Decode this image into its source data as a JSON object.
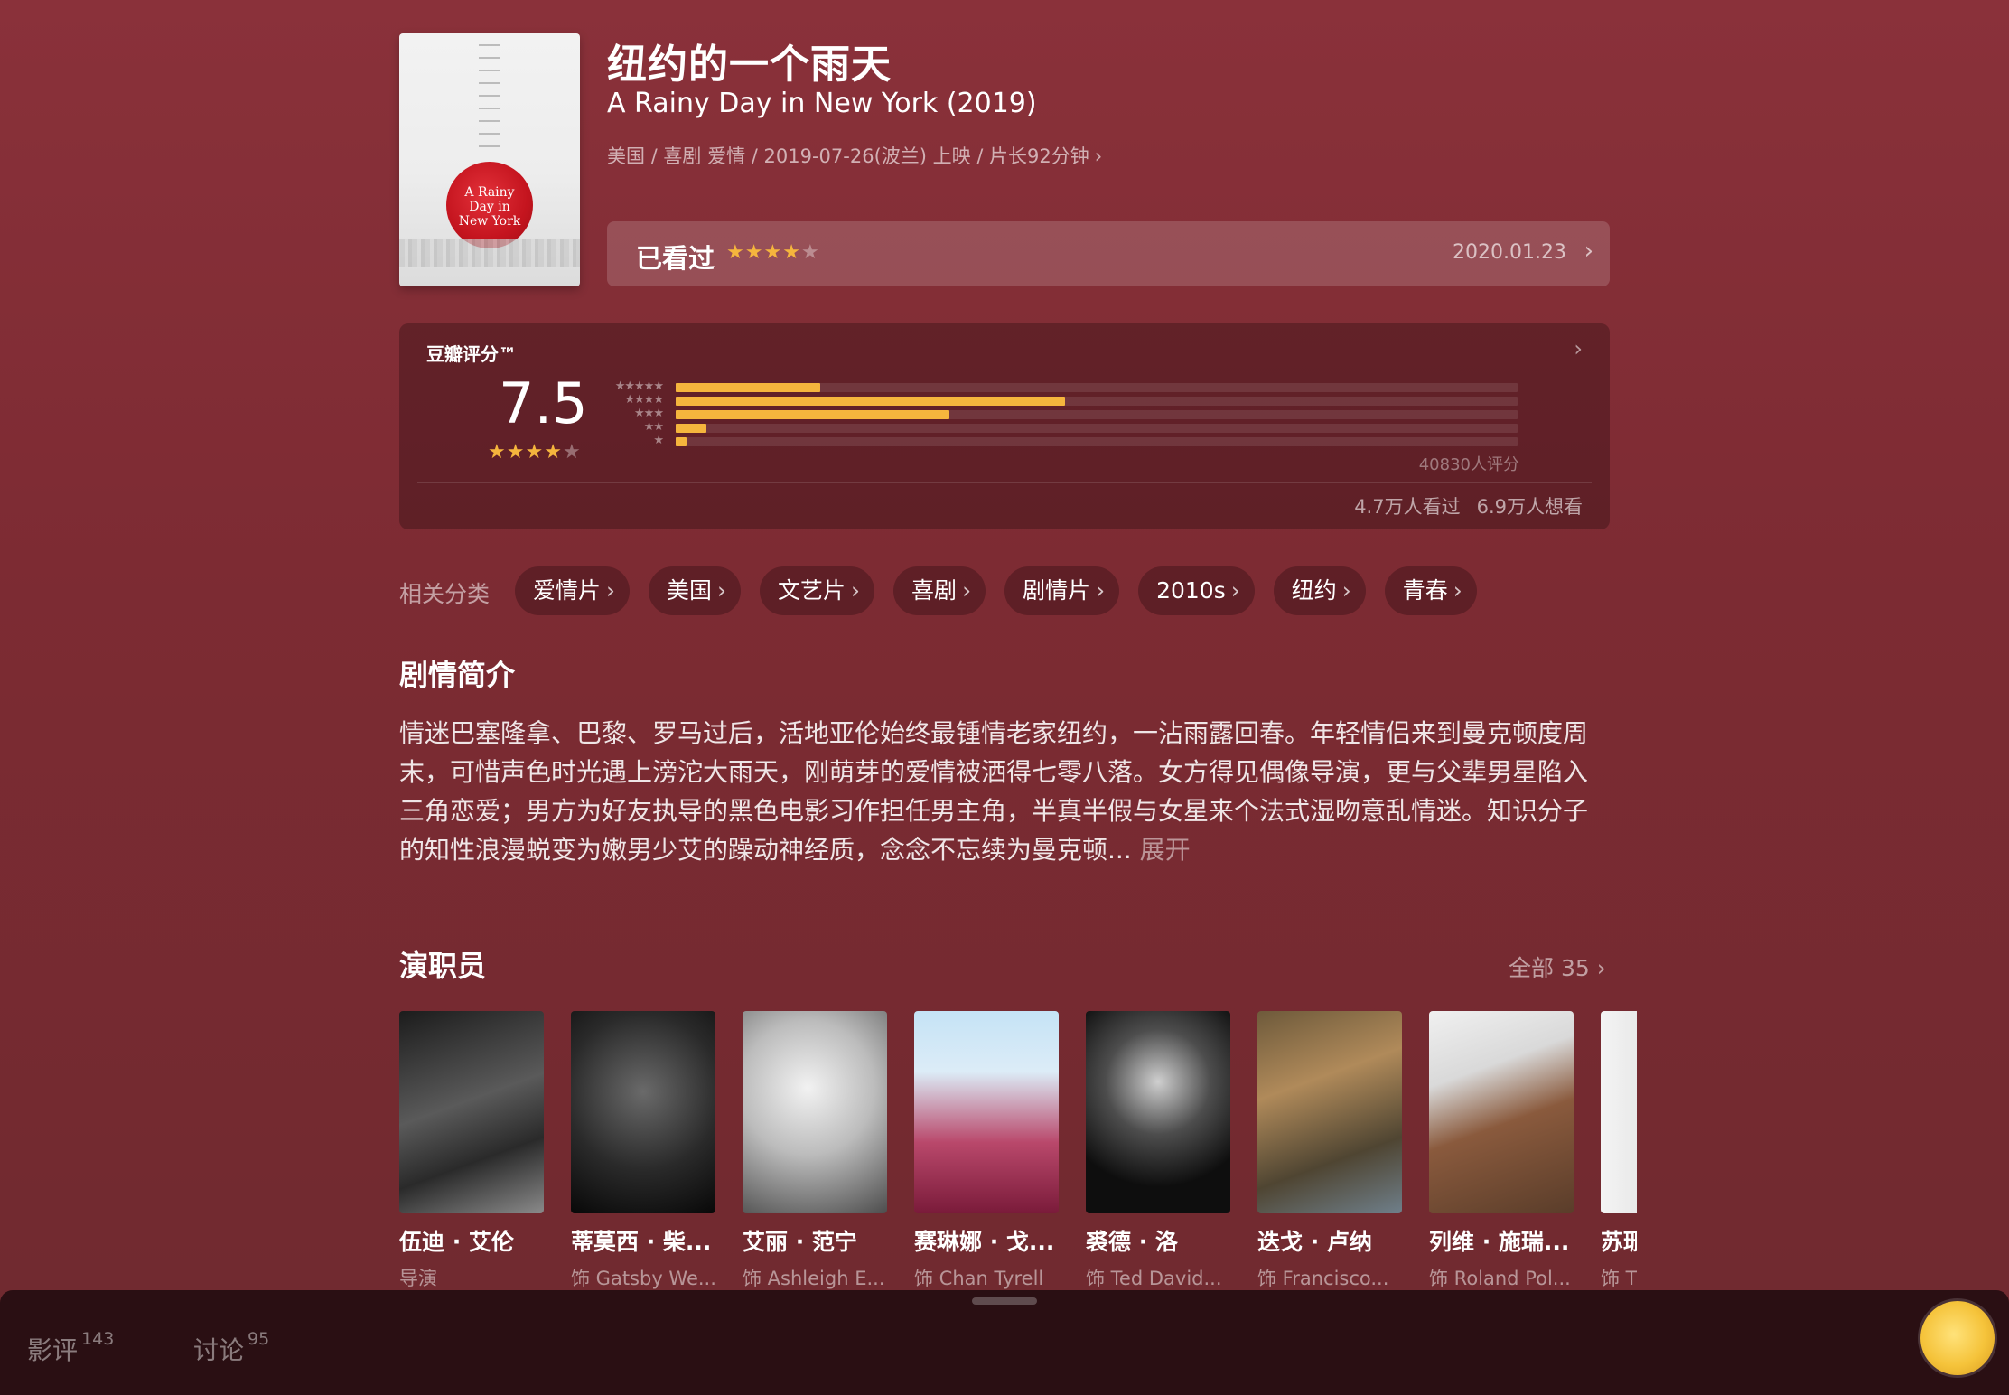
{
  "movie": {
    "title_cn": "纽约的一个雨天",
    "title_en": "A Rainy Day in New York (2019)",
    "meta": "美国 / 喜剧 爱情 / 2019-07-26(波兰) 上映 / 片长92分钟",
    "poster_text": "A Rainy Day in New York"
  },
  "watched": {
    "label": "已看过",
    "stars": 4,
    "date": "2020.01.23"
  },
  "rating": {
    "title": "豆瓣评分™",
    "score": "7.5",
    "stars": 4,
    "distribution": [
      {
        "stars": 5,
        "fraction": 0.172
      },
      {
        "stars": 4,
        "fraction": 0.462
      },
      {
        "stars": 3,
        "fraction": 0.325
      },
      {
        "stars": 2,
        "fraction": 0.036
      },
      {
        "stars": 1,
        "fraction": 0.013
      }
    ],
    "count": "40830人评分",
    "seen": "4.7万人看过",
    "want": "6.9万人想看"
  },
  "related": {
    "label": "相关分类",
    "tags": [
      "爱情片",
      "美国",
      "文艺片",
      "喜剧",
      "剧情片",
      "2010s",
      "纽约",
      "青春"
    ]
  },
  "synopsis": {
    "title": "剧情简介",
    "text": "情迷巴塞隆拿、巴黎、罗马过后，活地亚伦始终最锺情老家纽约，一沾雨露回春。年轻情侣来到曼克顿度周末，可惜声色时光遇上滂沱大雨天，刚萌芽的爱情被洒得七零八落。女方得见偶像导演，更与父辈男星陷入三角恋爱；男方为好友执导的黑色电影习作担任男主角，半真半假与女星来个法式湿吻意乱情迷。知识分子的知性浪漫蜕变为嫩男少艾的躁动神经质，念念不忘续为曼克顿...",
    "more": "展开"
  },
  "cast": {
    "title": "演职员",
    "all": "全部 35",
    "members": [
      {
        "name": "伍迪 · 艾伦",
        "role": "导演"
      },
      {
        "name": "蒂莫西 · 柴...",
        "role": "饰 Gatsby We..."
      },
      {
        "name": "艾丽 · 范宁",
        "role": "饰 Ashleigh E..."
      },
      {
        "name": "赛琳娜 · 戈...",
        "role": "饰 Chan Tyrell"
      },
      {
        "name": "裘德 · 洛",
        "role": "饰 Ted David..."
      },
      {
        "name": "迭戈 · 卢纳",
        "role": "饰 Francisco..."
      },
      {
        "name": "列维 · 施瑞...",
        "role": "饰 Roland Pol..."
      },
      {
        "name": "苏珊",
        "role": "饰 T"
      }
    ]
  },
  "bottom": {
    "reviews_label": "影评",
    "reviews_count": "143",
    "discuss_label": "讨论",
    "discuss_count": "95"
  },
  "colors": {
    "background": "#8a313a",
    "star": "#f5b53d"
  },
  "icons": [
    "chevron-right-icon",
    "star-icon",
    "avatar-icon"
  ]
}
